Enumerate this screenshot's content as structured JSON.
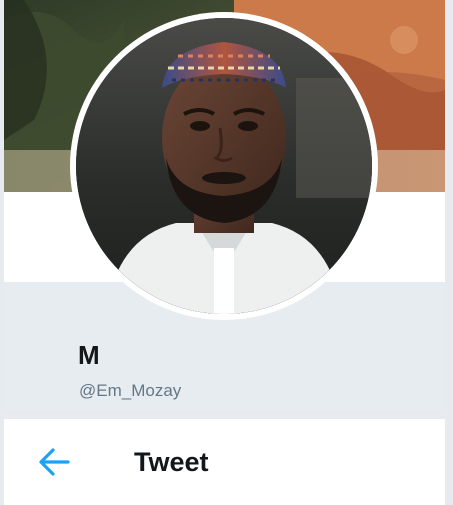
{
  "profile": {
    "display_name": "M",
    "handle": "@Em_Mozay"
  },
  "header": {
    "title": "Tweet",
    "back_icon": "arrow-left-icon"
  },
  "colors": {
    "accent": "#1da1f2",
    "name_area_bg": "#e6ecf0",
    "handle_text": "#657786"
  }
}
